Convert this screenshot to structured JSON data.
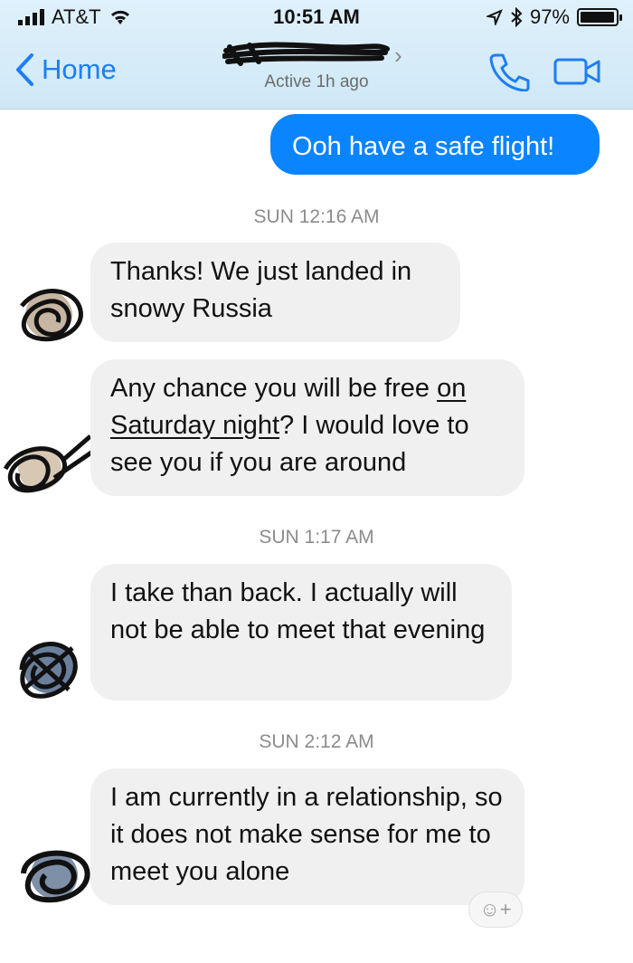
{
  "status": {
    "carrier": "AT&T",
    "time": "10:51 AM",
    "battery": "97%"
  },
  "nav": {
    "back": "Home",
    "active_status": "Active 1h ago"
  },
  "messages": {
    "m1": "Ooh have a safe flight!",
    "t1": "SUN 12:16 AM",
    "m2": "Thanks! We just landed in snowy Russia",
    "m3_a": "Any chance you will be free ",
    "m3_u": "on Saturday night",
    "m3_b": "? I would love to see you if you are around",
    "t2": "SUN 1:17 AM",
    "m4": "I take than back. I actually will not be able to meet that evening",
    "t3": "SUN 2:12 AM",
    "m5": "I am currently in a relationship, so it does not make sense for me to meet you alone"
  },
  "icons": {
    "back": "chevron-left-icon",
    "call": "phone-icon",
    "video": "video-camera-icon",
    "react": "emoji-plus-icon"
  },
  "colors": {
    "accent": "#0b84ff",
    "incoming": "#f1f0f0",
    "header": "#d9eef9"
  }
}
